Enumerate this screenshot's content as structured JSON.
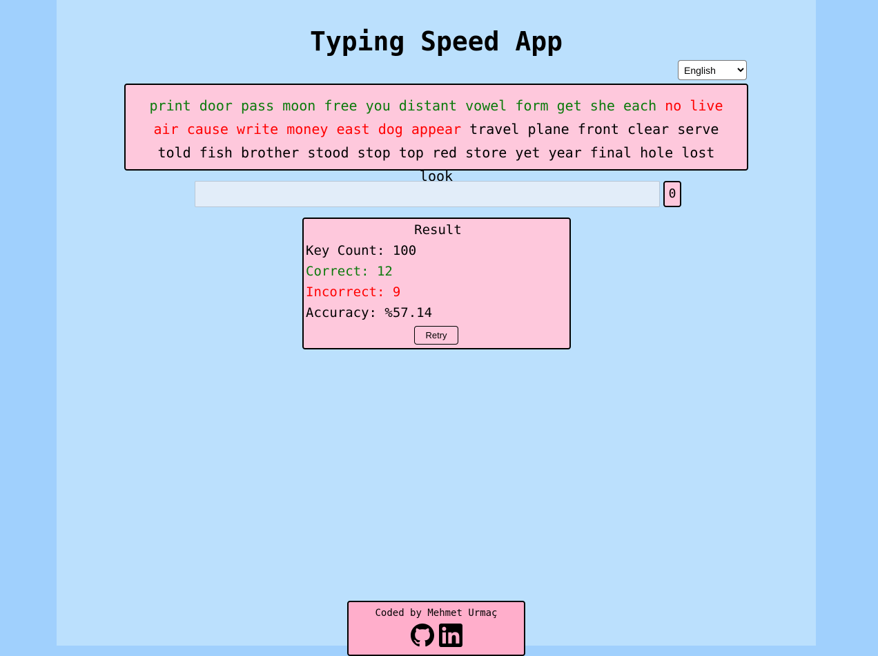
{
  "app": {
    "title": "Typing Speed App"
  },
  "language_select": {
    "selected": "English"
  },
  "words": [
    {
      "text": "print",
      "status": "correct"
    },
    {
      "text": "door",
      "status": "correct"
    },
    {
      "text": "pass",
      "status": "correct"
    },
    {
      "text": "moon",
      "status": "correct"
    },
    {
      "text": "free",
      "status": "correct"
    },
    {
      "text": "you",
      "status": "correct"
    },
    {
      "text": "distant",
      "status": "correct"
    },
    {
      "text": "vowel",
      "status": "correct"
    },
    {
      "text": "form",
      "status": "correct"
    },
    {
      "text": "get",
      "status": "correct"
    },
    {
      "text": "she",
      "status": "correct"
    },
    {
      "text": "each",
      "status": "correct"
    },
    {
      "text": "no",
      "status": "incorrect"
    },
    {
      "text": "live",
      "status": "incorrect"
    },
    {
      "text": "air",
      "status": "incorrect"
    },
    {
      "text": "cause",
      "status": "incorrect"
    },
    {
      "text": "write",
      "status": "incorrect"
    },
    {
      "text": "money",
      "status": "incorrect"
    },
    {
      "text": "east",
      "status": "incorrect"
    },
    {
      "text": "dog",
      "status": "incorrect"
    },
    {
      "text": "appear",
      "status": "incorrect"
    },
    {
      "text": "travel",
      "status": "pending"
    },
    {
      "text": "plane",
      "status": "pending"
    },
    {
      "text": "front",
      "status": "pending"
    },
    {
      "text": "clear",
      "status": "pending"
    },
    {
      "text": "serve",
      "status": "pending"
    },
    {
      "text": "told",
      "status": "pending"
    },
    {
      "text": "fish",
      "status": "pending"
    },
    {
      "text": "brother",
      "status": "pending"
    },
    {
      "text": "stood",
      "status": "pending"
    },
    {
      "text": "stop",
      "status": "pending"
    },
    {
      "text": "top",
      "status": "pending"
    },
    {
      "text": "red",
      "status": "pending"
    },
    {
      "text": "store",
      "status": "pending"
    },
    {
      "text": "yet",
      "status": "pending"
    },
    {
      "text": "year",
      "status": "pending"
    },
    {
      "text": "final",
      "status": "pending"
    },
    {
      "text": "hole",
      "status": "pending"
    },
    {
      "text": "lost",
      "status": "pending"
    },
    {
      "text": "look",
      "status": "pending"
    }
  ],
  "input": {
    "value": "",
    "placeholder": ""
  },
  "timer": {
    "value": "0"
  },
  "result": {
    "title": "Result",
    "key_count": "Key Count: 100",
    "correct": "Correct: 12",
    "incorrect": "Incorrect: 9",
    "accuracy": "Accuracy: %57.14",
    "retry_label": "Retry"
  },
  "footer": {
    "text": "Coded by Mehmet Urmaç",
    "icons": [
      "github-icon",
      "linkedin-icon"
    ]
  },
  "colors": {
    "outer_background": "#a0d0fd",
    "page_background": "#bbe0fd",
    "box_pink": "#fec8dc",
    "footer_pink": "#ffaecb",
    "correct": "#0b7a0b",
    "incorrect": "#ff0000"
  }
}
